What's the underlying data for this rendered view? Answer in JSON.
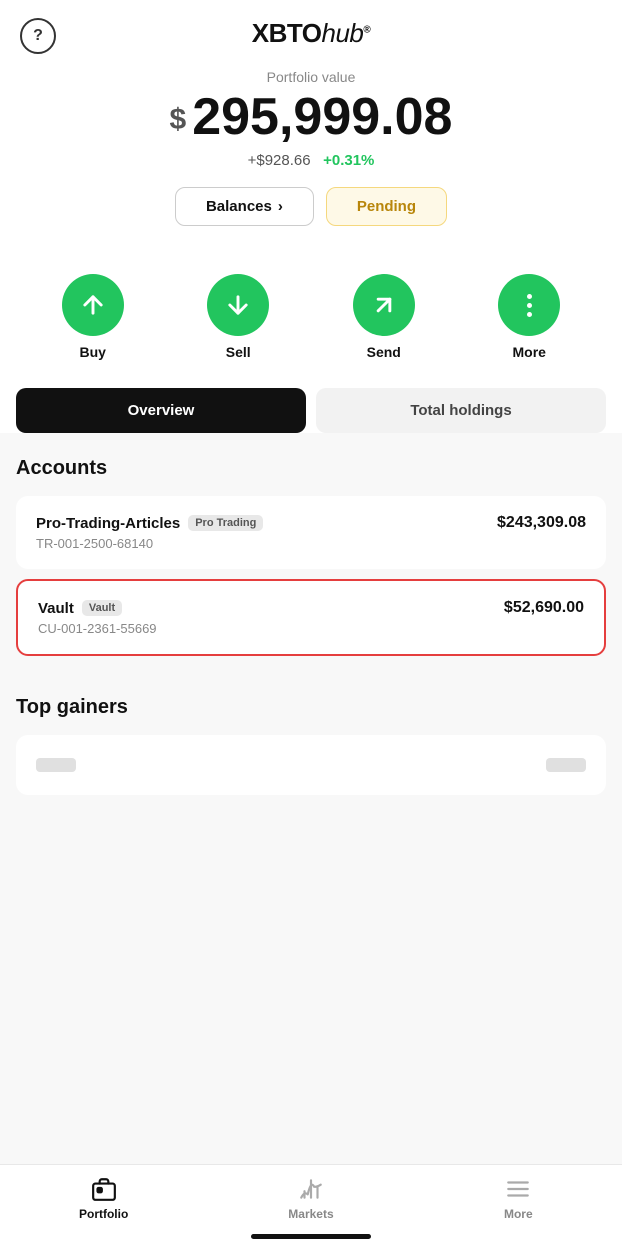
{
  "header": {
    "help_icon": "?",
    "logo_part1": "XBTO",
    "logo_part2": "hub",
    "logo_sup": "®"
  },
  "portfolio": {
    "label": "Portfolio value",
    "dollar_sign": "$",
    "value": "295,999.08",
    "change_amount": "+$928.66",
    "change_percent": "+0.31%"
  },
  "buttons": {
    "balances_label": "Balances",
    "balances_chevron": "›",
    "pending_label": "Pending"
  },
  "actions": [
    {
      "id": "buy",
      "label": "Buy",
      "icon": "up-arrow"
    },
    {
      "id": "sell",
      "label": "Sell",
      "icon": "down-arrow"
    },
    {
      "id": "send",
      "label": "Send",
      "icon": "send-arrow"
    },
    {
      "id": "more",
      "label": "More",
      "icon": "dots"
    }
  ],
  "tabs": [
    {
      "id": "overview",
      "label": "Overview",
      "active": true
    },
    {
      "id": "total-holdings",
      "label": "Total holdings",
      "active": false
    }
  ],
  "accounts": {
    "section_title": "Accounts",
    "items": [
      {
        "name": "Pro-Trading-Articles",
        "badge": "Pro Trading",
        "id": "TR-001-2500-68140",
        "amount": "$243,309.08",
        "highlighted": false
      },
      {
        "name": "Vault",
        "badge": "Vault",
        "id": "CU-001-2361-55669",
        "amount": "$52,690.00",
        "highlighted": true
      }
    ]
  },
  "top_gainers": {
    "section_title": "Top gainers"
  },
  "bottom_nav": {
    "items": [
      {
        "id": "portfolio",
        "label": "Portfolio",
        "icon": "portfolio-icon",
        "active": true
      },
      {
        "id": "markets",
        "label": "Markets",
        "icon": "markets-icon",
        "active": false
      },
      {
        "id": "more",
        "label": "More",
        "icon": "more-icon",
        "active": false
      }
    ]
  }
}
